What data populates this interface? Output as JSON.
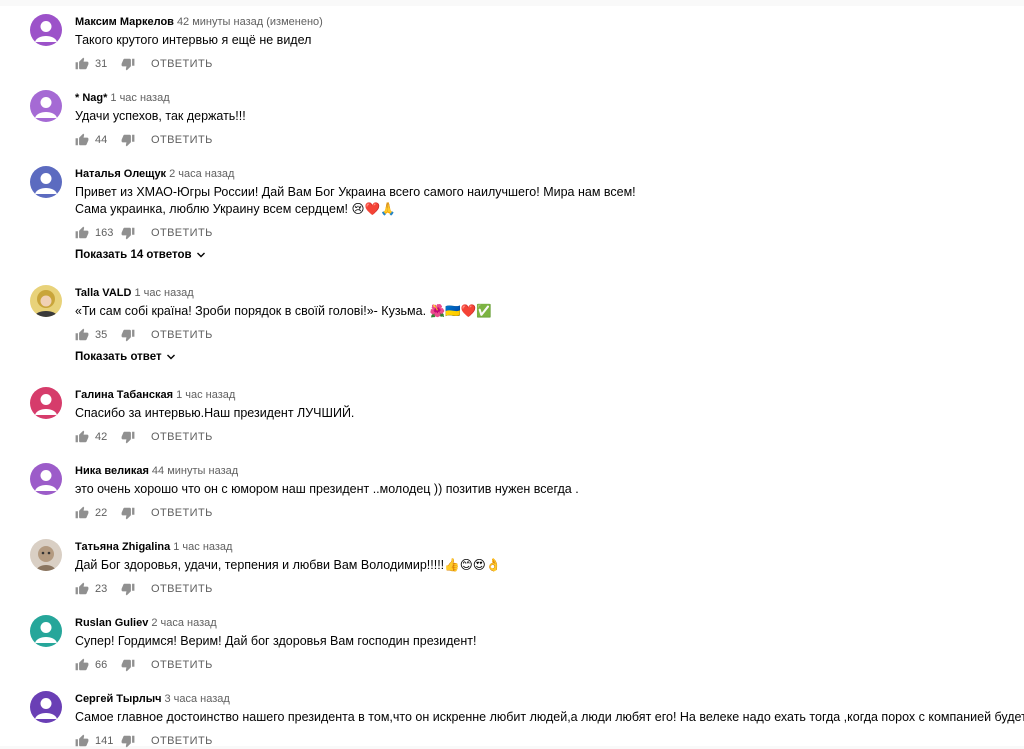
{
  "comments": [
    {
      "author": "Максим Маркелов",
      "time": "42 минуты назад (изменено)",
      "text": [
        "Такого крутого интервью я ещё не видел"
      ],
      "likes": "31",
      "reply": "ОТВЕТИТЬ",
      "avatar_color": "#9c52c9",
      "avatar": "person-icon"
    },
    {
      "author": "* Nag*",
      "time": "1 час назад",
      "text": [
        "Удачи успехов, так держать!!!"
      ],
      "likes": "44",
      "reply": "ОТВЕТИТЬ",
      "avatar_color": "#a56ad4",
      "avatar": "person-icon"
    },
    {
      "author": "Наталья Олещук",
      "time": "2 часа назад",
      "text": [
        "Привет из ХМАО-Югры России! Дай Вам Бог Украина всего самого наилучшего! Мира нам всем!",
        "Сама украинка, люблю Украину всем сердцем! 😢❤️🙏"
      ],
      "likes": "163",
      "reply": "ОТВЕТИТЬ",
      "replies": "Показать 14 ответов",
      "avatar_color": "#5c6bc0",
      "avatar": "person-icon"
    },
    {
      "author": "Talla VALD",
      "time": "1 час назад",
      "text": [
        "«Ти сам собі країна! Зроби порядок в своїй голові!»- Кузьма. 🌺🇺🇦❤️✅"
      ],
      "likes": "35",
      "reply": "ОТВЕТИТЬ",
      "replies": "Показать ответ",
      "avatar_color": "#c9a53a",
      "avatar": "photo-avatar"
    },
    {
      "author": "Галина Табанская",
      "time": "1 час назад",
      "text": [
        "Спасибо за интервью.Наш президент  ЛУЧШИЙ."
      ],
      "likes": "42",
      "reply": "ОТВЕТИТЬ",
      "avatar_color": "#d63c6b",
      "avatar": "person-icon"
    },
    {
      "author": "Ника великая",
      "time": "44 минуты назад",
      "text": [
        "это очень хорошо что он с юмором наш президент ..молодец )) позитив нужен всегда ."
      ],
      "likes": "22",
      "reply": "ОТВЕТИТЬ",
      "avatar_color": "#9c5cc9",
      "avatar": "person-icon"
    },
    {
      "author": "Татьяна Zhigalina",
      "time": "1 час назад",
      "text": [
        "Дай Бог здоровья, удачи, терпения и любви Вам Володимир!!!!!👍😊😍👌"
      ],
      "likes": "23",
      "reply": "ОТВЕТИТЬ",
      "avatar_color": "#b39a80",
      "avatar": "photo-avatar"
    },
    {
      "author": "Ruslan Guliev",
      "time": "2 часа назад",
      "text": [
        "Супер! Гордимся! Верим! Дай бог здоровья Вам господин президент!"
      ],
      "likes": "66",
      "reply": "ОТВЕТИТЬ",
      "avatar_color": "#26a69a",
      "avatar": "person-icon"
    },
    {
      "author": "Сергей Тырлыч",
      "time": "3 часа назад",
      "text": [
        "Самое главное достоинство нашего президента в том,что он искренне любит людей,а люди любят его! На велеке надо ехать тогда ,когда порох с компанией будет сидеть!"
      ],
      "likes": "141",
      "reply": "ОТВЕТИТЬ",
      "avatar_color": "#6a3fb5",
      "avatar": "person-icon"
    }
  ]
}
